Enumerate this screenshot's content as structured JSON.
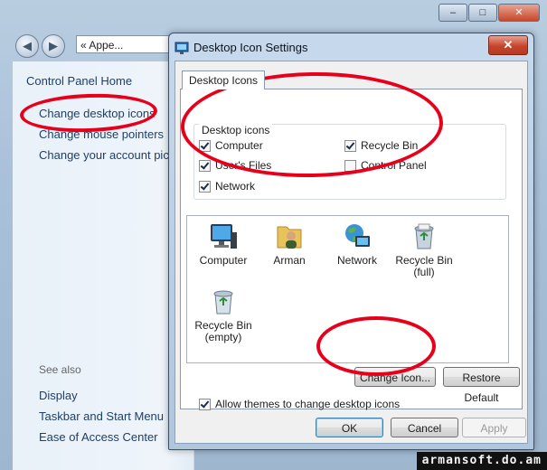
{
  "background_window": {
    "address_text": "« Appe...",
    "caption_buttons": {
      "minimize": "–",
      "maximize": "□",
      "close": "✕"
    },
    "links": [
      "Control Panel Home",
      "Change desktop icons",
      "Change mouse pointers",
      "Change your account pictu"
    ],
    "see_also_title": "See also",
    "see_also_links": [
      "Display",
      "Taskbar and Start Menu",
      "Ease of Access Center"
    ]
  },
  "dialog": {
    "title": "Desktop Icon Settings",
    "close_glyph": "✕",
    "tab_label": "Desktop Icons",
    "group_title": "Desktop icons",
    "checkboxes": [
      {
        "label": "Computer",
        "checked": true
      },
      {
        "label": "Recycle Bin",
        "checked": true
      },
      {
        "label": "User's Files",
        "checked": true
      },
      {
        "label": "Control Panel",
        "checked": false
      },
      {
        "label": "Network",
        "checked": true
      }
    ],
    "icons": [
      {
        "label": "Computer",
        "icon": "computer-icon"
      },
      {
        "label": "Arman",
        "icon": "user-folder-icon"
      },
      {
        "label": "Network",
        "icon": "network-icon"
      },
      {
        "label": "Recycle Bin (full)",
        "icon": "recycle-bin-full-icon"
      },
      {
        "label": "Recycle Bin (empty)",
        "icon": "recycle-bin-empty-icon"
      }
    ],
    "change_icon_label": "Change Icon...",
    "restore_default_label": "Restore Default",
    "themes_checkbox": {
      "label": "Allow themes to change desktop icons",
      "checked": true
    },
    "ok_label": "OK",
    "cancel_label": "Cancel",
    "apply_label": "Apply"
  },
  "watermark": "armansoft.do.am",
  "colors": {
    "annotation": "#e8001a",
    "link": "#1e3f66"
  }
}
